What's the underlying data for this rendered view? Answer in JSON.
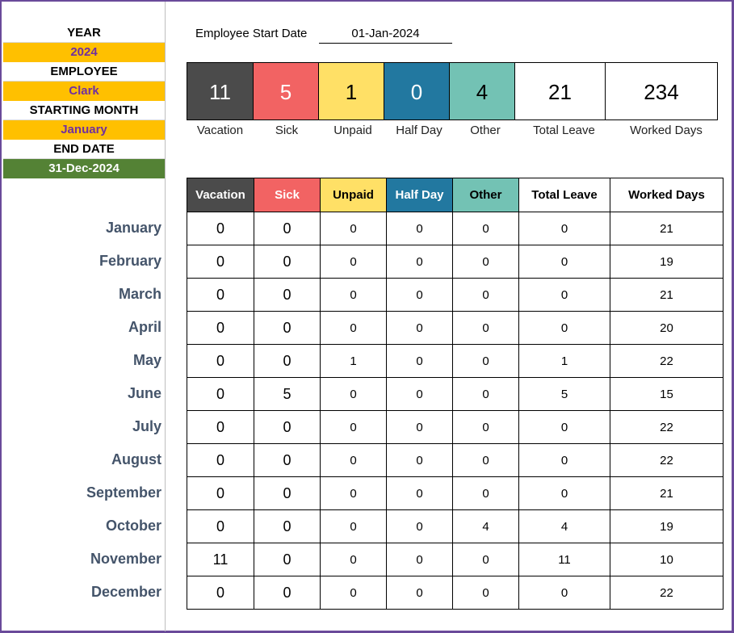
{
  "left_panel": {
    "year_label": "YEAR",
    "year_value": "2024",
    "employee_label": "EMPLOYEE",
    "employee_value": "Clark",
    "starting_month_label": "STARTING MONTH",
    "starting_month_value": "January",
    "end_date_label": "END DATE",
    "end_date_value": "31-Dec-2024"
  },
  "start_date": {
    "label": "Employee Start Date",
    "value": "01-Jan-2024"
  },
  "summary": [
    {
      "key": "vacation",
      "value": "11",
      "label": "Vacation"
    },
    {
      "key": "sick",
      "value": "5",
      "label": "Sick"
    },
    {
      "key": "unpaid",
      "value": "1",
      "label": "Unpaid"
    },
    {
      "key": "half-day",
      "value": "0",
      "label": "Half Day"
    },
    {
      "key": "other",
      "value": "4",
      "label": "Other"
    },
    {
      "key": "total-leave",
      "value": "21",
      "label": "Total Leave"
    },
    {
      "key": "worked-days",
      "value": "234",
      "label": "Worked Days"
    }
  ],
  "table": {
    "headers": [
      "Vacation",
      "Sick",
      "Unpaid",
      "Half Day",
      "Other",
      "Total Leave",
      "Worked Days"
    ],
    "rows": [
      {
        "month": "January",
        "cells": [
          "0",
          "0",
          "0",
          "0",
          "0",
          "0",
          "21"
        ]
      },
      {
        "month": "February",
        "cells": [
          "0",
          "0",
          "0",
          "0",
          "0",
          "0",
          "19"
        ]
      },
      {
        "month": "March",
        "cells": [
          "0",
          "0",
          "0",
          "0",
          "0",
          "0",
          "21"
        ]
      },
      {
        "month": "April",
        "cells": [
          "0",
          "0",
          "0",
          "0",
          "0",
          "0",
          "20"
        ]
      },
      {
        "month": "May",
        "cells": [
          "0",
          "0",
          "1",
          "0",
          "0",
          "1",
          "22"
        ]
      },
      {
        "month": "June",
        "cells": [
          "0",
          "5",
          "0",
          "0",
          "0",
          "5",
          "15"
        ]
      },
      {
        "month": "July",
        "cells": [
          "0",
          "0",
          "0",
          "0",
          "0",
          "0",
          "22"
        ]
      },
      {
        "month": "August",
        "cells": [
          "0",
          "0",
          "0",
          "0",
          "0",
          "0",
          "22"
        ]
      },
      {
        "month": "September",
        "cells": [
          "0",
          "0",
          "0",
          "0",
          "0",
          "0",
          "21"
        ]
      },
      {
        "month": "October",
        "cells": [
          "0",
          "0",
          "0",
          "0",
          "4",
          "4",
          "19"
        ]
      },
      {
        "month": "November",
        "cells": [
          "11",
          "0",
          "0",
          "0",
          "0",
          "11",
          "10"
        ]
      },
      {
        "month": "December",
        "cells": [
          "0",
          "0",
          "0",
          "0",
          "0",
          "0",
          "22"
        ]
      }
    ]
  },
  "colors": {
    "vacation": "#4b4b4b",
    "sick": "#f26363",
    "unpaid": "#ffe066",
    "half_day": "#2278a0",
    "other": "#73c2b4",
    "highlight": "#ffc000",
    "end_date": "#548235",
    "accent_text": "#7030a0",
    "month_text": "#44546a"
  }
}
